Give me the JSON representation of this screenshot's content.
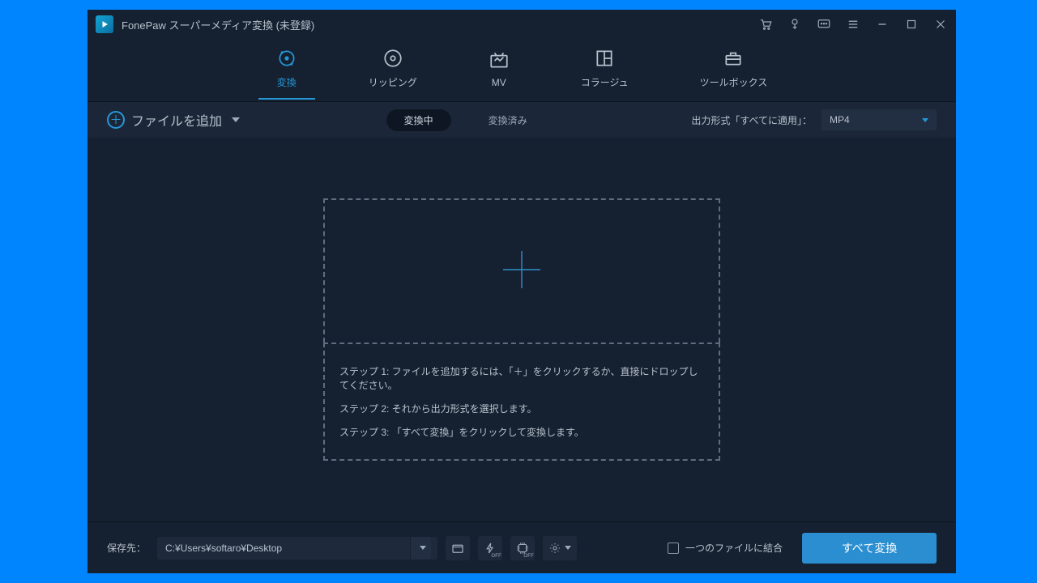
{
  "titlebar": {
    "app_name": "FonePaw スーパーメディア変換 (未登録)"
  },
  "tabs": {
    "convert": "変換",
    "ripping": "リッピング",
    "mv": "MV",
    "collage": "コラージュ",
    "toolbox": "ツールボックス"
  },
  "subbar": {
    "add_file": "ファイルを追加",
    "converting": "変換中",
    "converted": "変換済み",
    "output_label": "出力形式「すべてに適用」：",
    "output_value": "MP4"
  },
  "dropzone": {
    "step1": "ステップ 1: ファイルを追加するには、「＋」をクリックするか、直接にドロップしてください。",
    "step2": "ステップ 2: それから出力形式を選択します。",
    "step3": "ステップ 3: 「すべて変換」をクリックして変換します。"
  },
  "footer": {
    "save_to_label": "保存先：",
    "save_path": "C:¥Users¥softaro¥Desktop",
    "merge_label": "一つのファイルに結合",
    "convert_all": "すべて変換",
    "off": "OFF"
  }
}
